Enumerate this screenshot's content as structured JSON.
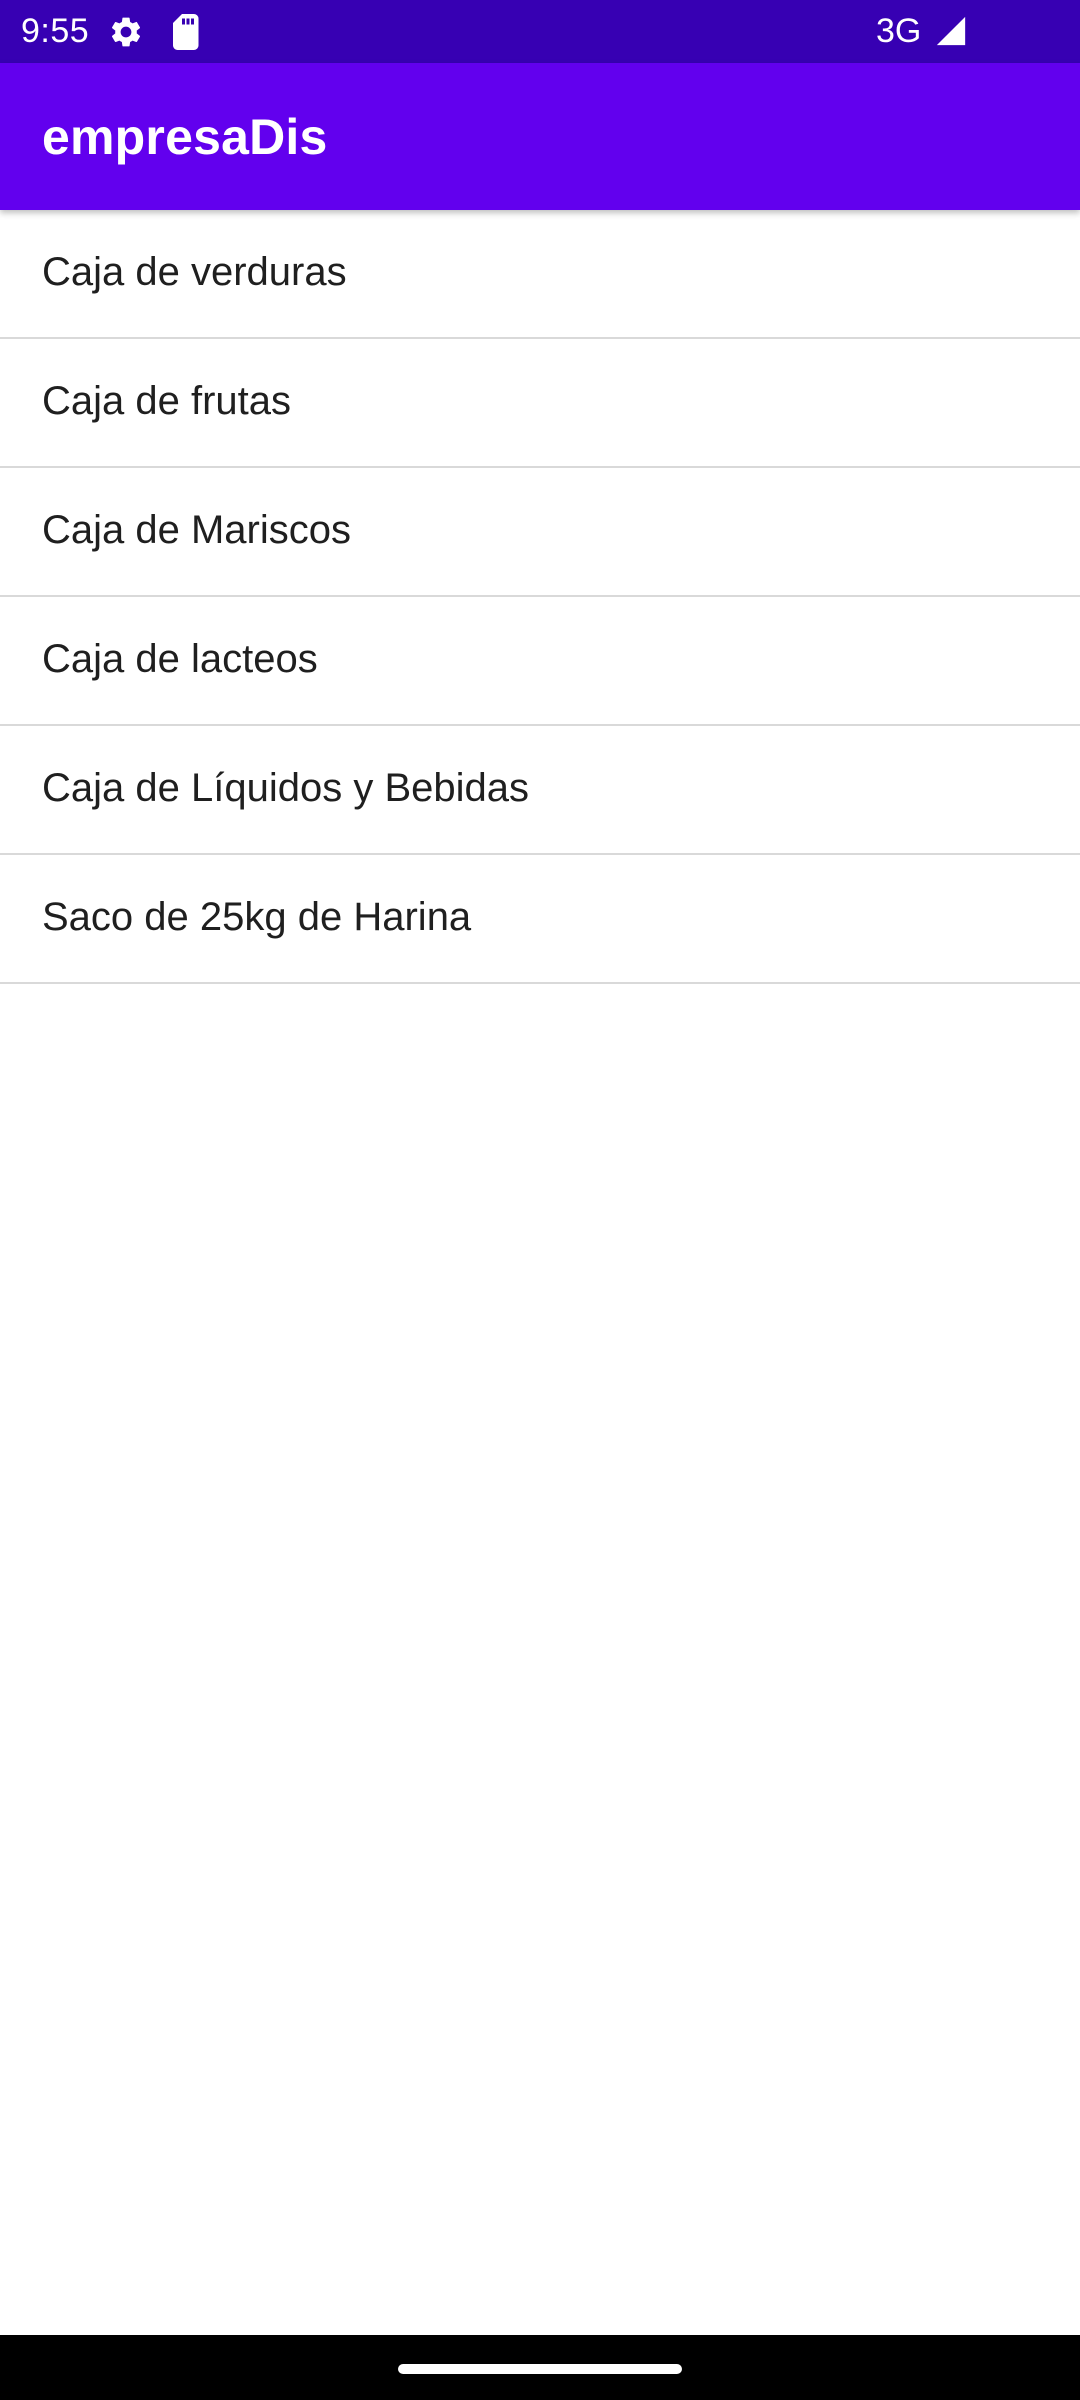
{
  "status_bar": {
    "time": "9:55",
    "network": "3G",
    "icons": [
      "gear-icon",
      "sd-card-icon",
      "signal-icon"
    ]
  },
  "app_bar": {
    "title": "empresaDis"
  },
  "items": [
    {
      "label": "Caja de verduras"
    },
    {
      "label": "Caja de frutas"
    },
    {
      "label": "Caja de Mariscos"
    },
    {
      "label": "Caja de lacteos"
    },
    {
      "label": "Caja de Líquidos y Bebidas"
    },
    {
      "label": "Saco de 25kg de Harina"
    }
  ],
  "colors": {
    "status_bar": "#3700b3",
    "app_bar": "#6200ee",
    "background": "#ffffff",
    "divider": "#d9d9d9"
  }
}
